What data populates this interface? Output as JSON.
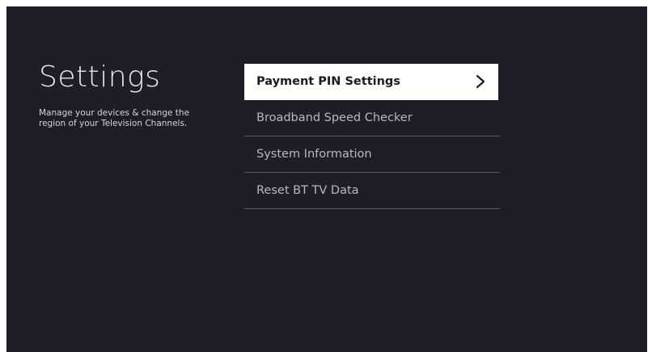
{
  "screen": {
    "title": "Settings",
    "subtitle": "Manage your devices & change the region of your Television Channels."
  },
  "menu": {
    "items": [
      {
        "label": "Payment PIN Settings",
        "selected": true,
        "icon": "chevron-right-icon"
      },
      {
        "label": "Broadband Speed Checker",
        "selected": false
      },
      {
        "label": "System Information",
        "selected": false
      },
      {
        "label": "Reset BT TV Data",
        "selected": false
      }
    ]
  },
  "colors": {
    "background": "#1f1d25",
    "selected_background": "#ffffff",
    "selected_text": "#1a1a22",
    "item_text": "#b9b7c0",
    "divider": "#5a5860"
  }
}
